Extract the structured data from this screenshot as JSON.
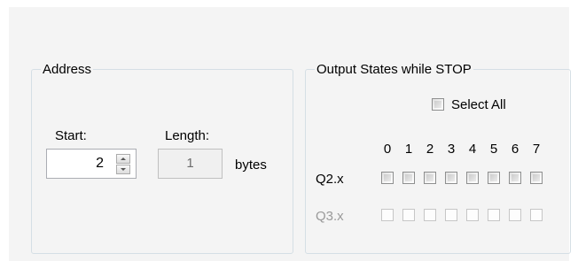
{
  "address": {
    "title": "Address",
    "start_label": "Start:",
    "start_value": "2",
    "length_label": "Length:",
    "length_value": "1",
    "length_unit": "bytes"
  },
  "output_states": {
    "title": "Output States while STOP",
    "select_all_label": "Select All",
    "select_all_checked": false,
    "bit_numbers": [
      "0",
      "1",
      "2",
      "3",
      "4",
      "5",
      "6",
      "7"
    ],
    "rows": [
      {
        "label": "Q2.x",
        "enabled": true,
        "bits": [
          false,
          false,
          false,
          false,
          false,
          false,
          false,
          false
        ]
      },
      {
        "label": "Q3.x",
        "enabled": false,
        "bits": [
          false,
          false,
          false,
          false,
          false,
          false,
          false,
          false
        ]
      }
    ]
  }
}
